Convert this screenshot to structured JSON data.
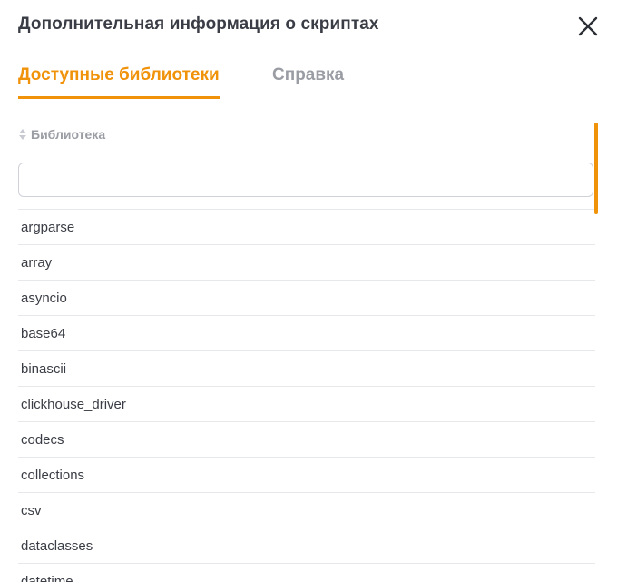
{
  "dialog": {
    "title": "Дополнительная информация о скриптах",
    "close_icon": "close-icon"
  },
  "tabs": [
    {
      "label": "Доступные библиотеки",
      "active": true
    },
    {
      "label": "Справка",
      "active": false
    }
  ],
  "table": {
    "column_header": "Библиотека",
    "sort_icon": "sort-icon",
    "filter_value": "",
    "rows": [
      "argparse",
      "array",
      "asyncio",
      "base64",
      "binascii",
      "clickhouse_driver",
      "codecs",
      "collections",
      "csv",
      "dataclasses",
      "datetime"
    ]
  },
  "colors": {
    "accent": "#f0920a",
    "text": "#3a3d45",
    "muted": "#9a9da4",
    "divider": "#e6e8ec"
  }
}
